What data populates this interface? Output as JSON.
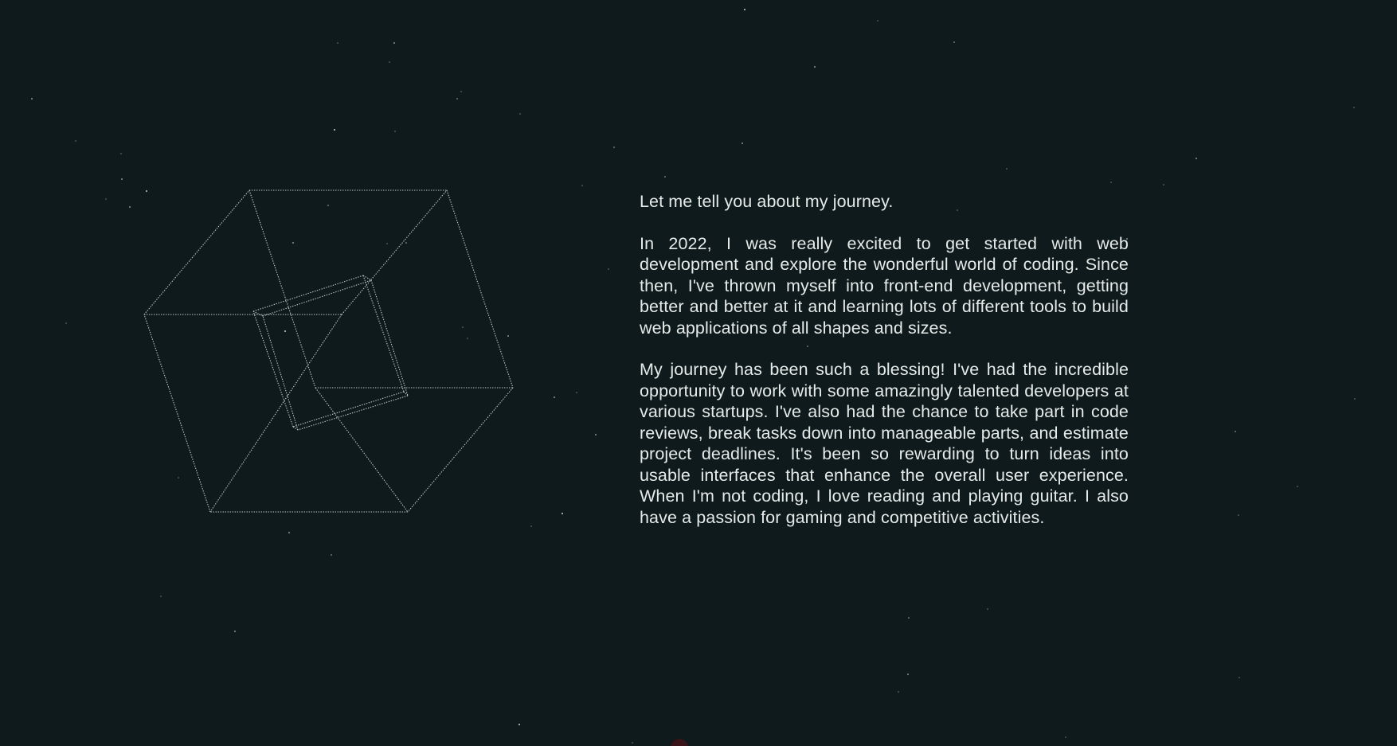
{
  "about": {
    "intro": "Let me tell you about my journey.",
    "paragraph_1": "In 2022, I was really excited to get started with web development and explore the wonderful world of coding. Since then, I've thrown myself into front-end development, getting better and better at it and learning lots of different tools to build web applications of all shapes and sizes.",
    "paragraph_2": "My journey has been such a blessing! I've had the incredible opportunity to work with some amazingly talented developers at various startups. I've also had the chance to take part in code reviews, break tasks down into manageable parts, and estimate project deadlines. It's been so rewarding to turn ideas into usable interfaces that enhance the overall user experience. When I'm not coding, I love reading and playing guitar. I also have a passion for gaming and competitive activities."
  },
  "colors": {
    "background": "#0e1a1b",
    "text": "#e6ebea",
    "stars": "#b9c4c3",
    "wireframe": "#d4dcdb"
  },
  "graphic": {
    "type": "rotating tesseract wireframe",
    "style": "dotted lines"
  }
}
